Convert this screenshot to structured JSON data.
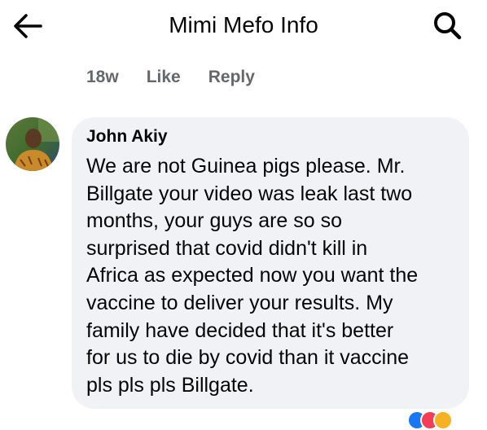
{
  "header": {
    "title": "Mimi Mefo Info",
    "back_icon": "arrow-left-icon",
    "search_icon": "search-icon"
  },
  "parent_comment_meta": {
    "time": "18w",
    "like_label": "Like",
    "reply_label": "Reply"
  },
  "comment": {
    "author": "John Akiy",
    "avatar_icon": "user-avatar",
    "lines": [
      "We are not Guinea pigs please. Mr.",
      "Billgate your video was leak last two",
      "months, your guys are so so",
      "surprised that covid didn't kill in",
      "Africa as expected now you want the",
      "vaccine to deliver your results. My",
      "family have decided that it's better",
      "for us to die by covid than it vaccine",
      "pls pls pls Billgate."
    ]
  },
  "reactions": {
    "icons": [
      "like-reaction-icon",
      "love-reaction-icon",
      "haha-reaction-icon"
    ],
    "colors": [
      "#1877f2",
      "#f33e58",
      "#f7b125"
    ]
  },
  "colors": {
    "bubble_bg": "#f0f2f5",
    "meta_text": "#65676b",
    "primary_text": "#050505"
  }
}
